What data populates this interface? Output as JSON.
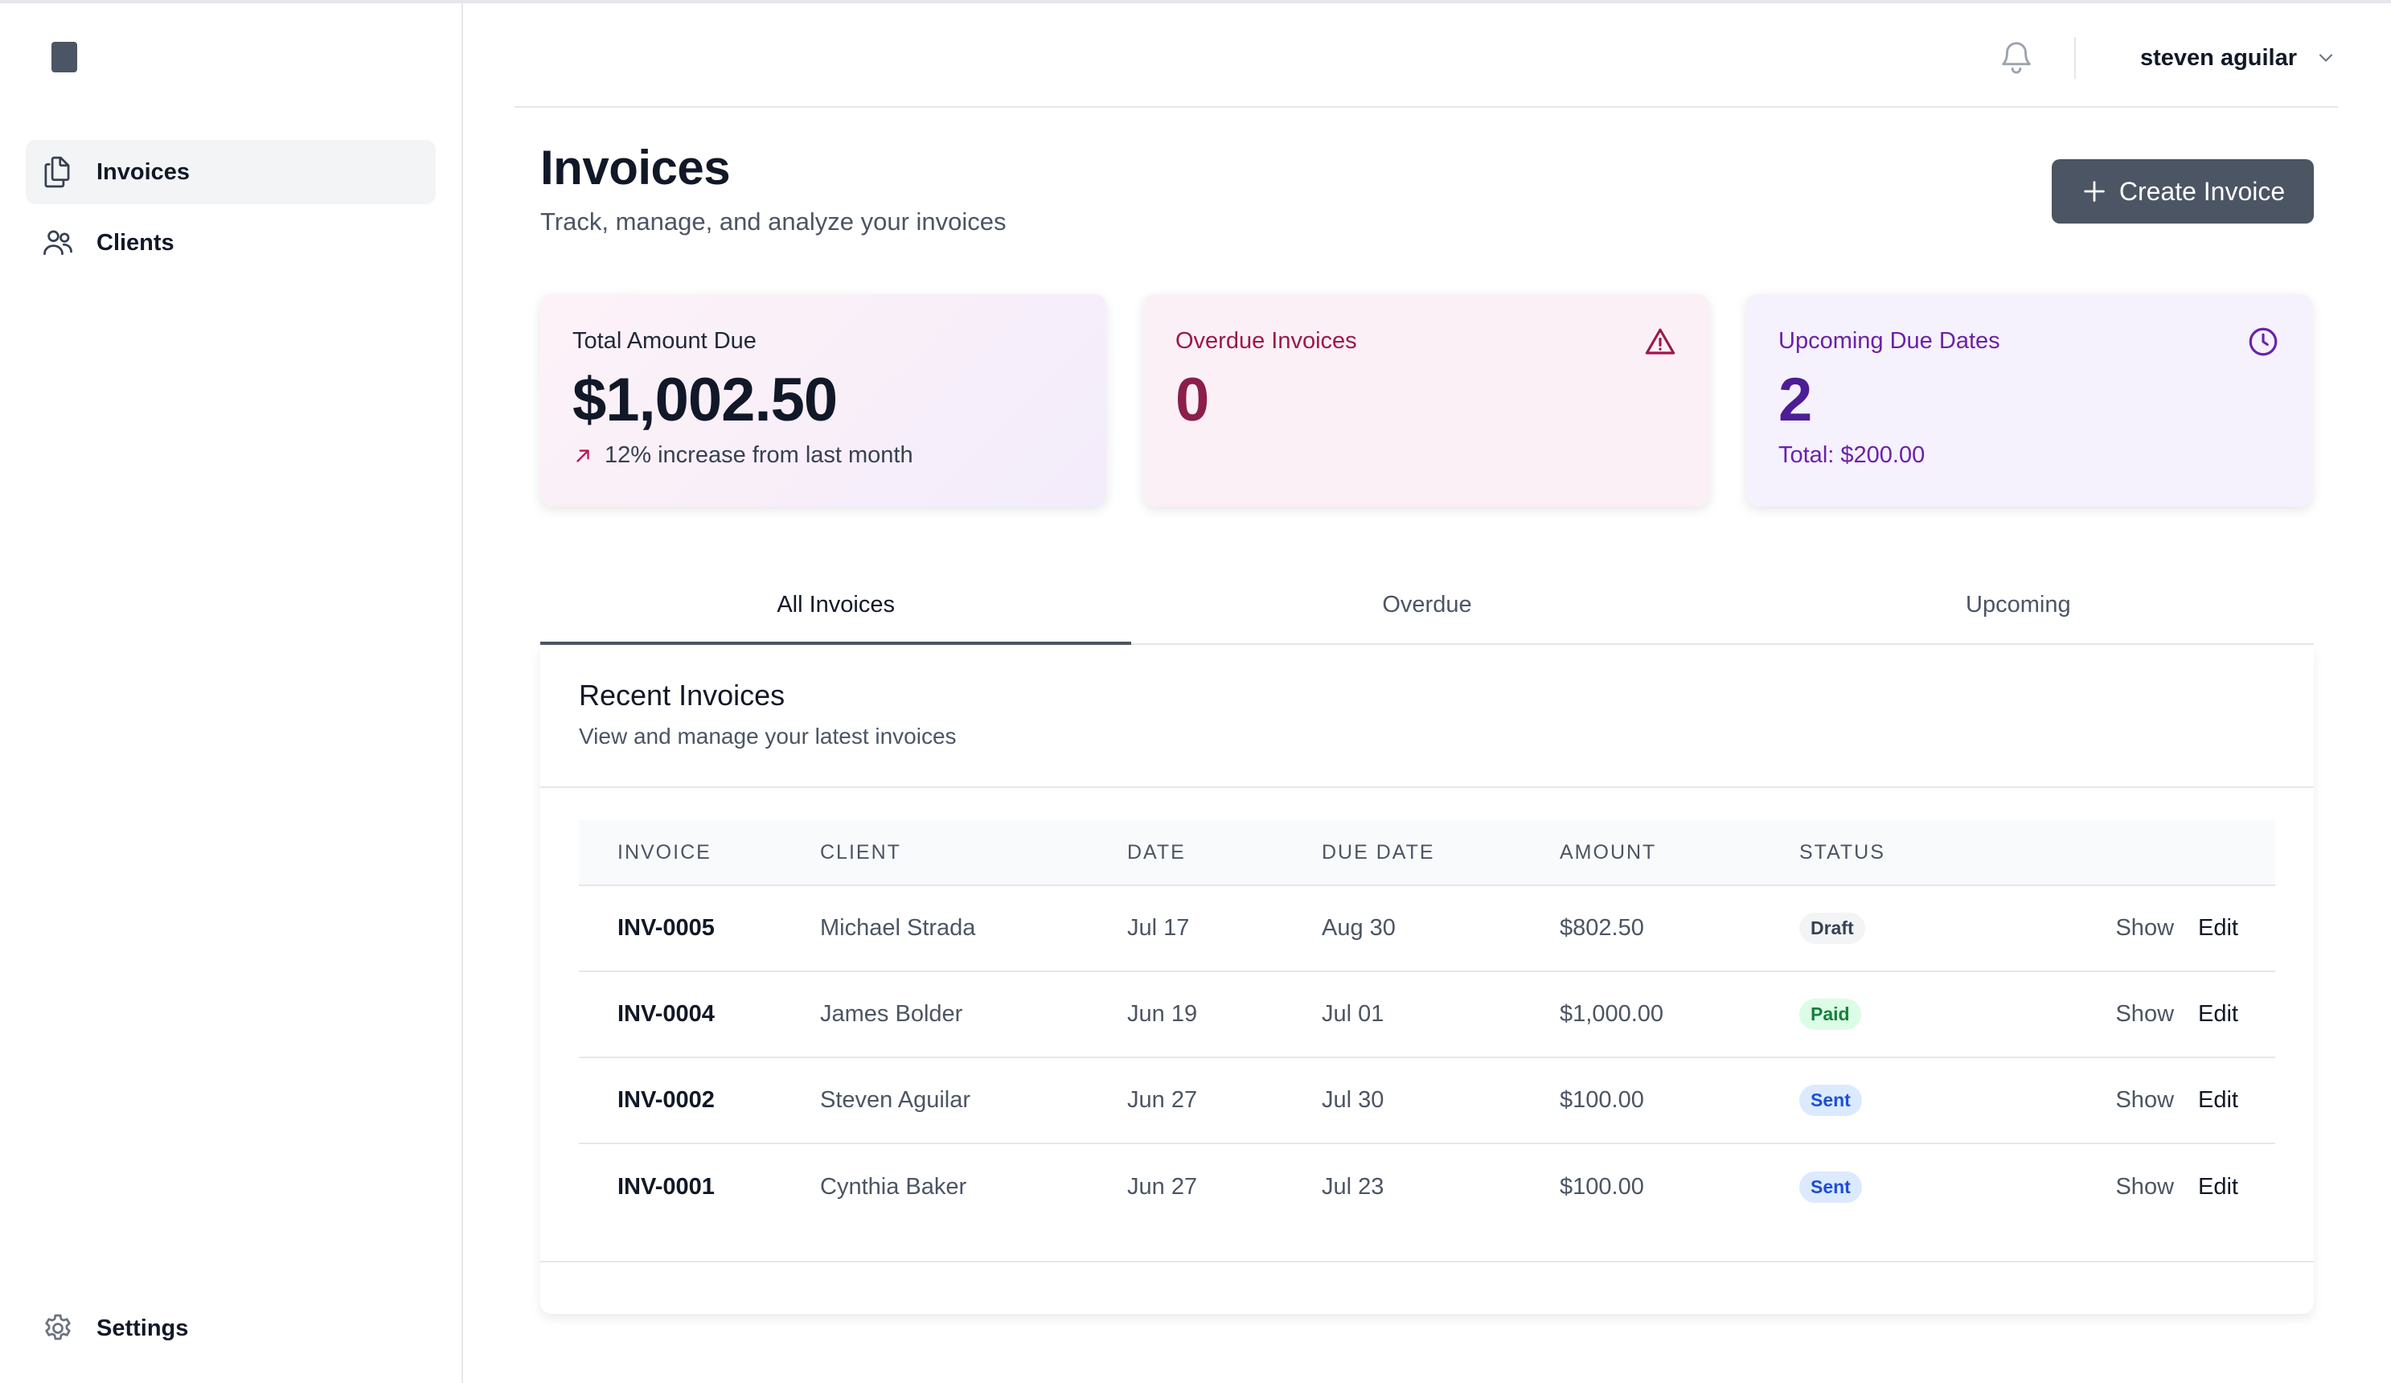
{
  "sidebar": {
    "items": [
      {
        "label": "Invoices",
        "icon": "documents-icon"
      },
      {
        "label": "Clients",
        "icon": "users-icon"
      }
    ],
    "settings_label": "Settings"
  },
  "topbar": {
    "user_name": "steven aguilar"
  },
  "header": {
    "title": "Invoices",
    "subtitle": "Track, manage, and analyze your invoices",
    "create_label": "Create Invoice"
  },
  "cards": {
    "total": {
      "label": "Total Amount Due",
      "value": "$1,002.50",
      "foot": "12% increase from last month"
    },
    "overdue": {
      "label": "Overdue Invoices",
      "value": "0"
    },
    "upcoming": {
      "label": "Upcoming Due Dates",
      "value": "2",
      "foot": "Total: $200.00"
    }
  },
  "tabs": [
    {
      "label": "All Invoices",
      "active": true
    },
    {
      "label": "Overdue",
      "active": false
    },
    {
      "label": "Upcoming",
      "active": false
    }
  ],
  "panel": {
    "title": "Recent Invoices",
    "subtitle": "View and manage your latest invoices"
  },
  "table": {
    "headers": [
      "Invoice",
      "Client",
      "Date",
      "Due Date",
      "Amount",
      "Status"
    ],
    "rows": [
      {
        "invoice": "INV-0005",
        "client": "Michael Strada",
        "date": "Jul 17",
        "due": "Aug 30",
        "amount": "$802.50",
        "status": "Draft",
        "show": "Show",
        "edit": "Edit"
      },
      {
        "invoice": "INV-0004",
        "client": "James Bolder",
        "date": "Jun 19",
        "due": "Jul 01",
        "amount": "$1,000.00",
        "status": "Paid",
        "show": "Show",
        "edit": "Edit"
      },
      {
        "invoice": "INV-0002",
        "client": "Steven Aguilar",
        "date": "Jun 27",
        "due": "Jul 30",
        "amount": "$100.00",
        "status": "Sent",
        "show": "Show",
        "edit": "Edit"
      },
      {
        "invoice": "INV-0001",
        "client": "Cynthia Baker",
        "date": "Jun 27",
        "due": "Jul 23",
        "amount": "$100.00",
        "status": "Sent",
        "show": "Show",
        "edit": "Edit"
      }
    ]
  },
  "colors": {
    "primary_button": "#4b5563",
    "overdue_accent": "#9d174d",
    "upcoming_accent": "#6b21a8",
    "badge_paid": "#15803d",
    "badge_sent": "#1d4ed8"
  }
}
